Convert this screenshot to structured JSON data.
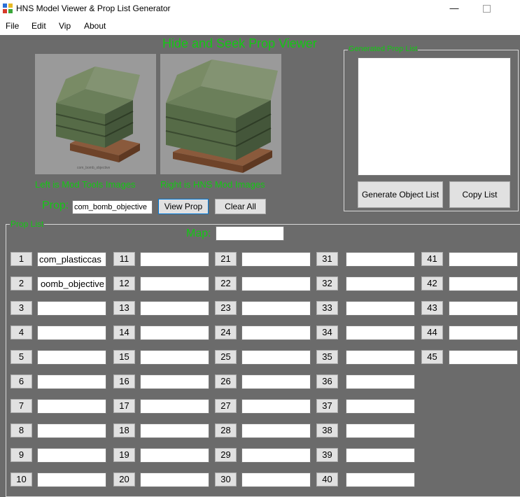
{
  "window": {
    "title": "HNS Model Viewer & Prop List Generator",
    "minimize_icon": "minimize-icon",
    "maximize_icon": "maximize-icon"
  },
  "menu": [
    {
      "label": "File"
    },
    {
      "label": "Edit"
    },
    {
      "label": "Vip"
    },
    {
      "label": "About"
    }
  ],
  "heading": "Hide and Seek Prop Viewer",
  "previews": {
    "left_caption": "Left is Mod Tools Images",
    "right_caption": "Right is HNS Mod Images",
    "left_image_text": "com_bomb_objective"
  },
  "prop": {
    "label": "Prop:",
    "value": "com_bomb_objective",
    "view_button": "View Prop",
    "clear_button": "Clear All"
  },
  "generated": {
    "group_label": "Generated Prop List",
    "text": "",
    "generate_button": "Generate Object List",
    "copy_button": "Copy List"
  },
  "prop_list": {
    "group_label": "Prop List",
    "map_label": "Map:",
    "map_value": "",
    "slots": [
      {
        "num": "1",
        "value": "com_plasticcas"
      },
      {
        "num": "2",
        "value": "oomb_objective"
      },
      {
        "num": "3",
        "value": ""
      },
      {
        "num": "4",
        "value": ""
      },
      {
        "num": "5",
        "value": ""
      },
      {
        "num": "6",
        "value": ""
      },
      {
        "num": "7",
        "value": ""
      },
      {
        "num": "8",
        "value": ""
      },
      {
        "num": "9",
        "value": ""
      },
      {
        "num": "10",
        "value": ""
      },
      {
        "num": "11",
        "value": ""
      },
      {
        "num": "12",
        "value": ""
      },
      {
        "num": "13",
        "value": ""
      },
      {
        "num": "14",
        "value": ""
      },
      {
        "num": "15",
        "value": ""
      },
      {
        "num": "16",
        "value": ""
      },
      {
        "num": "17",
        "value": ""
      },
      {
        "num": "18",
        "value": ""
      },
      {
        "num": "19",
        "value": ""
      },
      {
        "num": "20",
        "value": ""
      },
      {
        "num": "21",
        "value": ""
      },
      {
        "num": "22",
        "value": ""
      },
      {
        "num": "23",
        "value": ""
      },
      {
        "num": "24",
        "value": ""
      },
      {
        "num": "25",
        "value": ""
      },
      {
        "num": "26",
        "value": ""
      },
      {
        "num": "27",
        "value": ""
      },
      {
        "num": "28",
        "value": ""
      },
      {
        "num": "29",
        "value": ""
      },
      {
        "num": "30",
        "value": ""
      },
      {
        "num": "31",
        "value": ""
      },
      {
        "num": "32",
        "value": ""
      },
      {
        "num": "33",
        "value": ""
      },
      {
        "num": "34",
        "value": ""
      },
      {
        "num": "35",
        "value": ""
      },
      {
        "num": "36",
        "value": ""
      },
      {
        "num": "37",
        "value": ""
      },
      {
        "num": "38",
        "value": ""
      },
      {
        "num": "39",
        "value": ""
      },
      {
        "num": "40",
        "value": ""
      },
      {
        "num": "41",
        "value": ""
      },
      {
        "num": "42",
        "value": ""
      },
      {
        "num": "43",
        "value": ""
      },
      {
        "num": "44",
        "value": ""
      },
      {
        "num": "45",
        "value": ""
      }
    ]
  },
  "colors": {
    "background": "#6b6b6b",
    "accent_green": "#14c814"
  }
}
